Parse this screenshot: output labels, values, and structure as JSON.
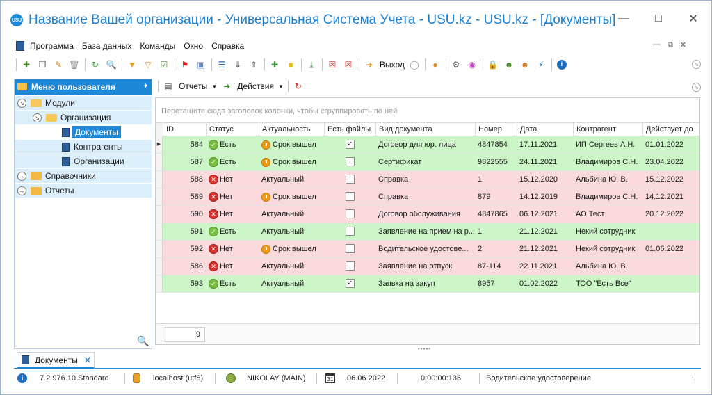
{
  "window": {
    "logo_text": "USU",
    "title": "Название Вашей организации - Универсальная Система Учета - USU.kz - USU.kz - [Документы]"
  },
  "menu": {
    "items": [
      "Программа",
      "База данных",
      "Команды",
      "Окно",
      "Справка"
    ]
  },
  "toolbar": {
    "exit_label": "Выход"
  },
  "sidebar": {
    "title": "Меню пользователя",
    "tree": {
      "modules": "Модули",
      "organization": "Организация",
      "documents": "Документы",
      "contragents": "Контрагенты",
      "organizations": "Организации",
      "references": "Справочники",
      "reports": "Отчеты"
    }
  },
  "right_toolbar": {
    "reports": "Отчеты",
    "actions": "Действия"
  },
  "grid": {
    "group_hint": "Перетащите сюда заголовок колонки, чтобы сгруппировать по ней",
    "columns": {
      "id": "ID",
      "status": "Статус",
      "actuality": "Актуальность",
      "has_files": "Есть файлы",
      "doc_type": "Вид документа",
      "number": "Номер",
      "date": "Дата",
      "contragent": "Контрагент",
      "valid_until": "Действует до"
    },
    "rows": [
      {
        "id": "584",
        "status": "Есть",
        "ok": true,
        "actuality": "Срок вышел",
        "expired": true,
        "files": true,
        "doc_type": "Договор для юр. лица",
        "number": "4847854",
        "date": "17.11.2021",
        "contragent": "ИП Сергеев А.Н.",
        "valid_until": "01.01.2022"
      },
      {
        "id": "587",
        "status": "Есть",
        "ok": true,
        "actuality": "Срок вышел",
        "expired": true,
        "files": false,
        "doc_type": "Сертификат",
        "number": "9822555",
        "date": "24.11.2021",
        "contragent": "Владимиров С.Н.",
        "valid_until": "23.04.2022"
      },
      {
        "id": "588",
        "status": "Нет",
        "ok": false,
        "actuality": "Актуальный",
        "expired": false,
        "files": false,
        "doc_type": "Справка",
        "number": "1",
        "date": "15.12.2020",
        "contragent": "Альбина Ю. В.",
        "valid_until": "15.12.2022"
      },
      {
        "id": "589",
        "status": "Нет",
        "ok": false,
        "actuality": "Срок вышел",
        "expired": true,
        "files": false,
        "doc_type": "Справка",
        "number": "879",
        "date": "14.12.2019",
        "contragent": "Владимиров С.Н.",
        "valid_until": "14.12.2021"
      },
      {
        "id": "590",
        "status": "Нет",
        "ok": false,
        "actuality": "Актуальный",
        "expired": false,
        "files": false,
        "doc_type": "Договор обслуживания",
        "number": "4847865",
        "date": "06.12.2021",
        "contragent": "АО Тест",
        "valid_until": "20.12.2022"
      },
      {
        "id": "591",
        "status": "Есть",
        "ok": true,
        "actuality": "Актуальный",
        "expired": false,
        "files": false,
        "doc_type": "Заявление на прием на р...",
        "number": "1",
        "date": "21.12.2021",
        "contragent": "Некий сотрудник",
        "valid_until": ""
      },
      {
        "id": "592",
        "status": "Нет",
        "ok": false,
        "actuality": "Срок вышел",
        "expired": true,
        "files": false,
        "doc_type": "Водительское удостове...",
        "number": "2",
        "date": "21.12.2021",
        "contragent": "Некий сотрудник",
        "valid_until": "01.06.2022"
      },
      {
        "id": "586",
        "status": "Нет",
        "ok": false,
        "actuality": "Актуальный",
        "expired": false,
        "files": false,
        "doc_type": "Заявление на отпуск",
        "number": "87-114",
        "date": "22.11.2021",
        "contragent": "Альбина Ю. В.",
        "valid_until": ""
      },
      {
        "id": "593",
        "status": "Есть",
        "ok": true,
        "actuality": "Актуальный",
        "expired": false,
        "files": true,
        "doc_type": "Заявка на закуп",
        "number": "8957",
        "date": "01.02.2022",
        "contragent": "ТОО \"Есть Все\"",
        "valid_until": ""
      }
    ],
    "footer_count": "9"
  },
  "doc_tabs": {
    "documents": "Документы"
  },
  "statusbar": {
    "version": "7.2.976.10 Standard",
    "db": "localhost (utf8)",
    "user": "NIKOLAY (MAIN)",
    "calendar_day": "31",
    "date": "06.06.2022",
    "timer": "0:00:00:136",
    "current": "Водительское удостоверение"
  },
  "colors": {
    "accent": "#1e88d8",
    "row_ok": "#ccf5c8",
    "row_bad": "#fadadd"
  }
}
